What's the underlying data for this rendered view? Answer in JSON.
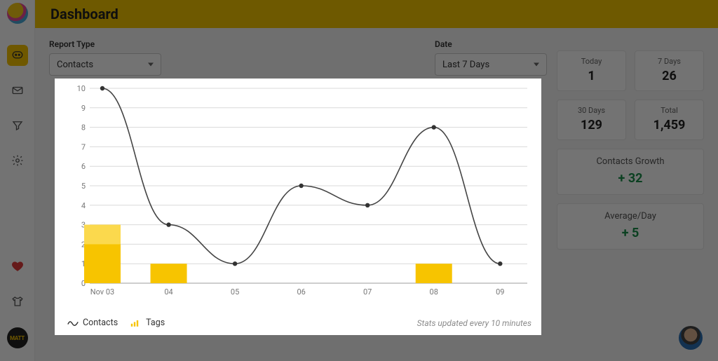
{
  "header": {
    "title": "Dashboard"
  },
  "controls": {
    "report_type": {
      "label": "Report Type",
      "value": "Contacts"
    },
    "date": {
      "label": "Date",
      "value": "Last 7 Days"
    }
  },
  "stats": {
    "today": {
      "label": "Today",
      "value": "1"
    },
    "days7": {
      "label": "7 Days",
      "value": "26"
    },
    "days30": {
      "label": "30 Days",
      "value": "129"
    },
    "total": {
      "label": "Total",
      "value": "1,459"
    },
    "growth": {
      "label": "Contacts Growth",
      "value": "+ 32"
    },
    "avg": {
      "label": "Average/Day",
      "value": "+ 5"
    }
  },
  "chart_legend": {
    "series1": "Contacts",
    "series2": "Tags",
    "footer": "Stats updated every 10 minutes"
  },
  "brand_badge": "MATT",
  "chart_data": {
    "type": "bar+line",
    "categories": [
      "Nov 03",
      "04",
      "05",
      "06",
      "07",
      "08",
      "09"
    ],
    "series": [
      {
        "name": "Contacts",
        "kind": "line",
        "values": [
          10,
          3,
          1,
          5,
          4,
          8,
          1
        ]
      },
      {
        "name": "Tags",
        "kind": "bar",
        "values": [
          3,
          1,
          0,
          0,
          0,
          1,
          0
        ],
        "secondary_values": [
          2,
          0,
          0,
          0,
          0,
          0,
          0
        ]
      }
    ],
    "ylabel": "",
    "xlabel": "",
    "ylim": [
      0,
      10
    ],
    "yticks": [
      0,
      1,
      2,
      3,
      4,
      5,
      6,
      7,
      8,
      9,
      10
    ],
    "grid": true,
    "legend_position": "bottom-left"
  }
}
